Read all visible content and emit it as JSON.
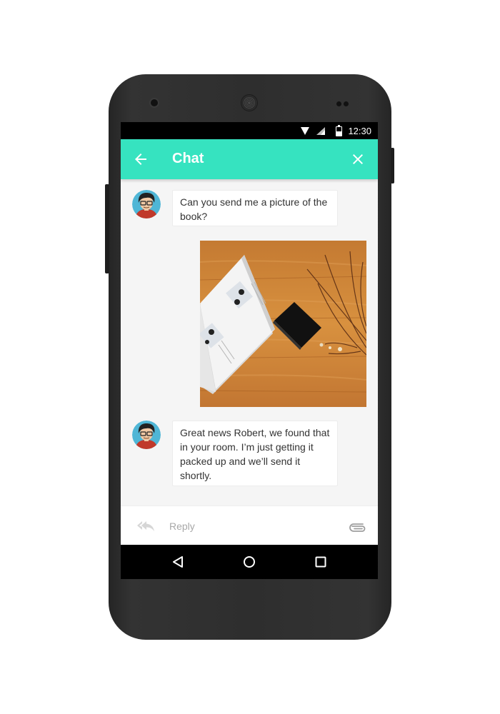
{
  "status_bar": {
    "time": "12:30",
    "icons": [
      "wifi-icon",
      "signal-icon",
      "battery-icon"
    ]
  },
  "app_bar": {
    "title": "Chat",
    "back_icon": "arrow-left-icon",
    "close_icon": "close-icon",
    "color": "#36e3c0"
  },
  "messages": [
    {
      "type": "text",
      "sender": "contact",
      "avatar": "avatar-cartoon",
      "text": "Can you send me a picture of the book?"
    },
    {
      "type": "image",
      "sender": "user",
      "image": "photo-open-book-on-wooden-table"
    },
    {
      "type": "text",
      "sender": "contact",
      "avatar": "avatar-cartoon",
      "text": "Great news Robert, we found that in your room. I’m just getting it packed up and we’ll send it shortly."
    }
  ],
  "reply_bar": {
    "placeholder": "Reply",
    "reply_icon": "reply-all-icon",
    "attach_icon": "paperclip-icon"
  },
  "nav_bar": {
    "icons": [
      "nav-back-icon",
      "nav-home-icon",
      "nav-recents-icon"
    ]
  }
}
